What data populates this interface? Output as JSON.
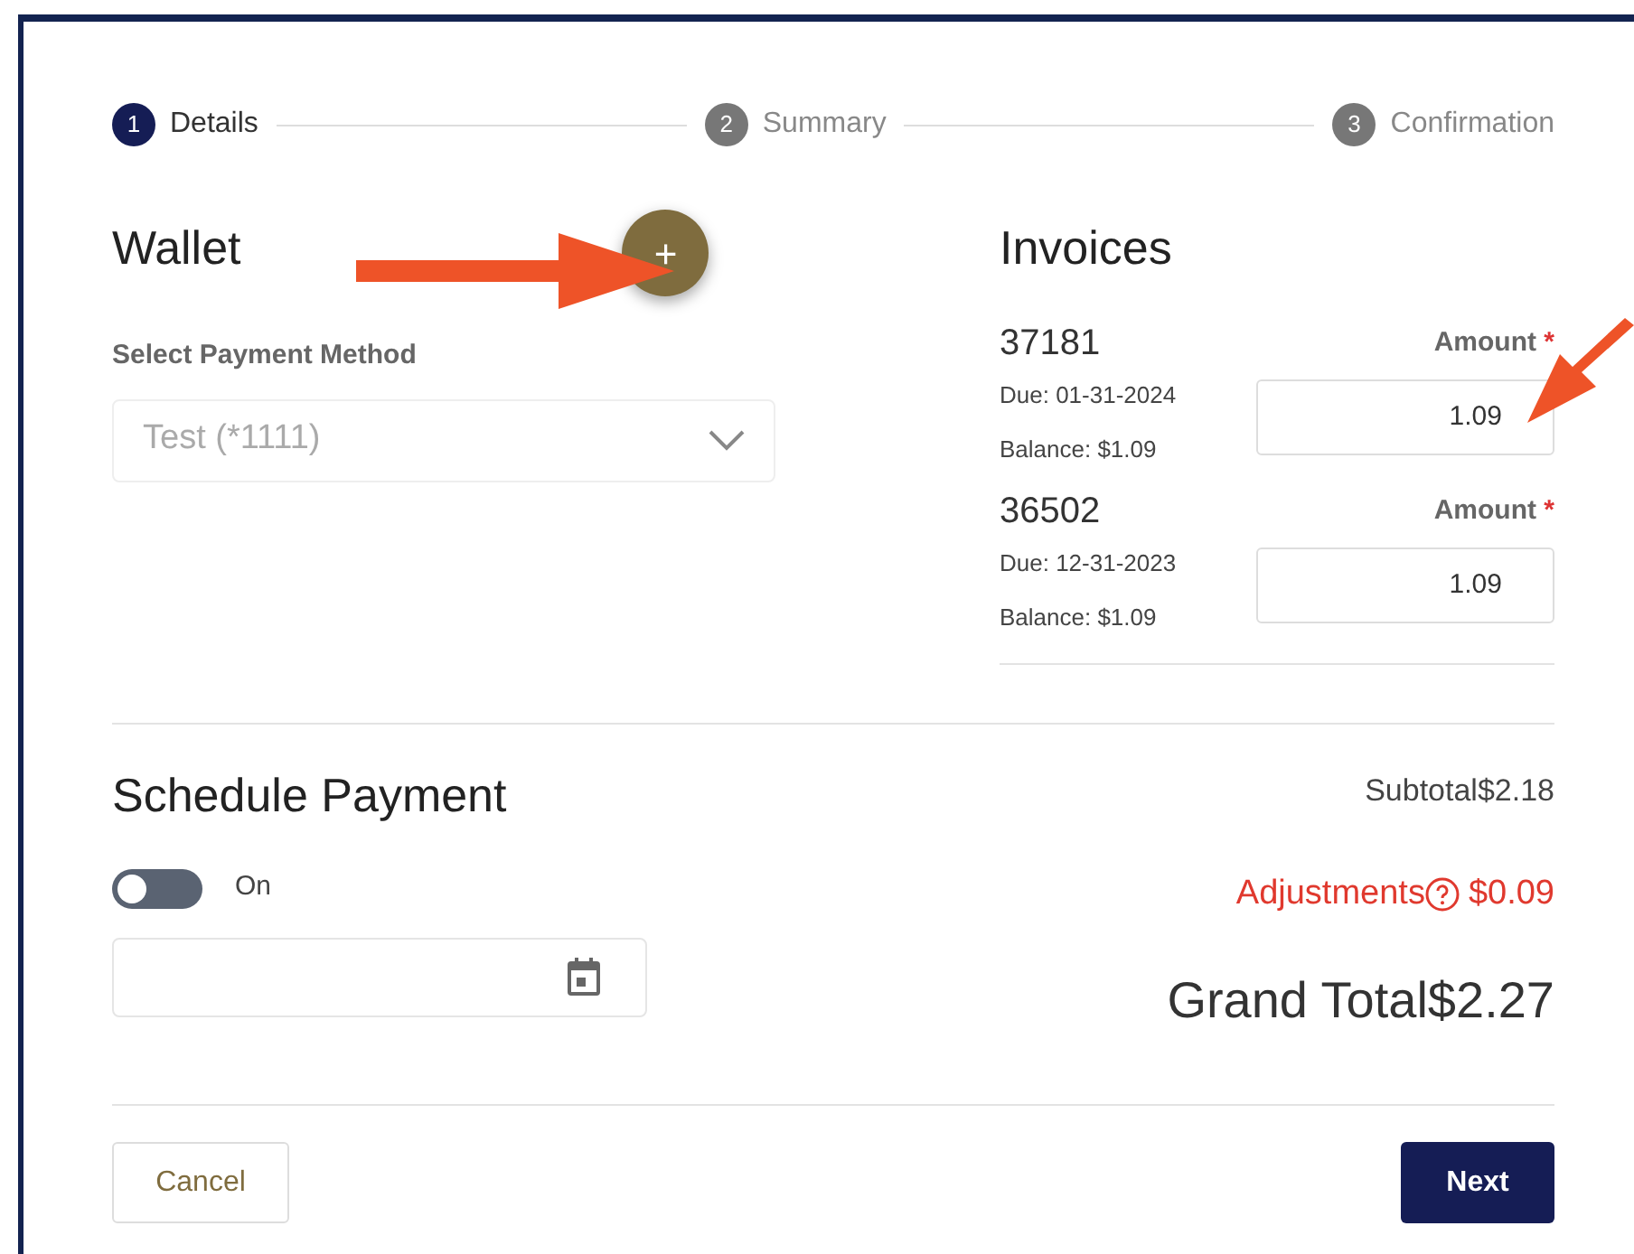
{
  "steps": [
    {
      "number": "1",
      "label": "Details",
      "selected": true
    },
    {
      "number": "2",
      "label": "Summary",
      "selected": false
    },
    {
      "number": "3",
      "label": "Confirmation",
      "selected": false
    }
  ],
  "wallet": {
    "title": "Wallet",
    "add_button": "+",
    "label": "Select Payment Method",
    "value": "Test (*1111)"
  },
  "invoices": {
    "title": "Invoices",
    "items": [
      {
        "number": "37181",
        "due": "Due: 01-31-2024",
        "balance": "Balance: $1.09",
        "amount_label": "Amount",
        "required_mark": "*",
        "amount": "1.09"
      },
      {
        "number": "36502",
        "due": "Due: 12-31-2023",
        "balance": "Balance: $1.09",
        "amount_label": "Amount",
        "required_mark": "*",
        "amount": "1.09"
      }
    ]
  },
  "schedule": {
    "title": "Schedule Payment",
    "toggle": {
      "label": "On",
      "on": false
    }
  },
  "totals": {
    "subtotal": "Subtotal$2.18",
    "adjustments_label": "Adjustments",
    "adjustments": "$0.09",
    "grand_total": "Grand Total$2.27"
  },
  "buttons": [
    {
      "label": "Cancel",
      "kind": "secondary"
    },
    {
      "label": "Next",
      "kind": "primary"
    }
  ]
}
